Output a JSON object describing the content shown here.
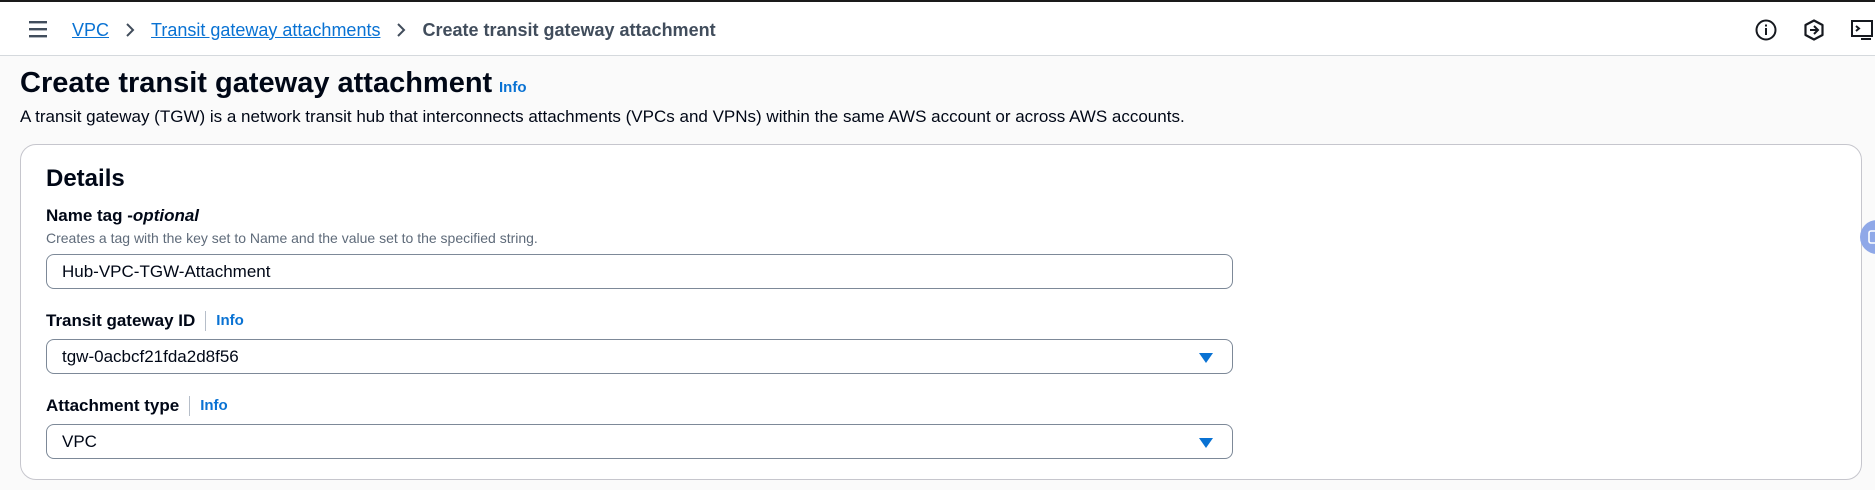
{
  "topbar": {
    "menu_icon": "hamburger-menu-icon",
    "breadcrumbs": [
      {
        "label": "VPC"
      },
      {
        "label": "Transit gateway attachments"
      },
      {
        "label": "Create transit gateway attachment"
      }
    ],
    "icons": [
      "info-circle-icon",
      "feedback-hexagon-icon",
      "cloudshell-icon"
    ]
  },
  "page": {
    "title": "Create transit gateway attachment",
    "info_label": "Info",
    "description": "A transit gateway (TGW) is a network transit hub that interconnects attachments (VPCs and VPNs) within the same AWS account or across AWS accounts."
  },
  "details": {
    "heading": "Details",
    "name_tag": {
      "label": "Name tag - ",
      "optional": "optional",
      "description": "Creates a tag with the key set to Name and the value set to the specified string.",
      "value": "Hub-VPC-TGW-Attachment"
    },
    "transit_gateway": {
      "label": "Transit gateway ID",
      "info_label": "Info",
      "value": "tgw-0acbcf21fda2d8f56"
    },
    "attachment_type": {
      "label": "Attachment type",
      "info_label": "Info",
      "value": "VPC"
    }
  },
  "colors": {
    "link": "#0972d3",
    "text": "#000716",
    "muted": "#5f6b7a",
    "border": "#7d8998"
  }
}
